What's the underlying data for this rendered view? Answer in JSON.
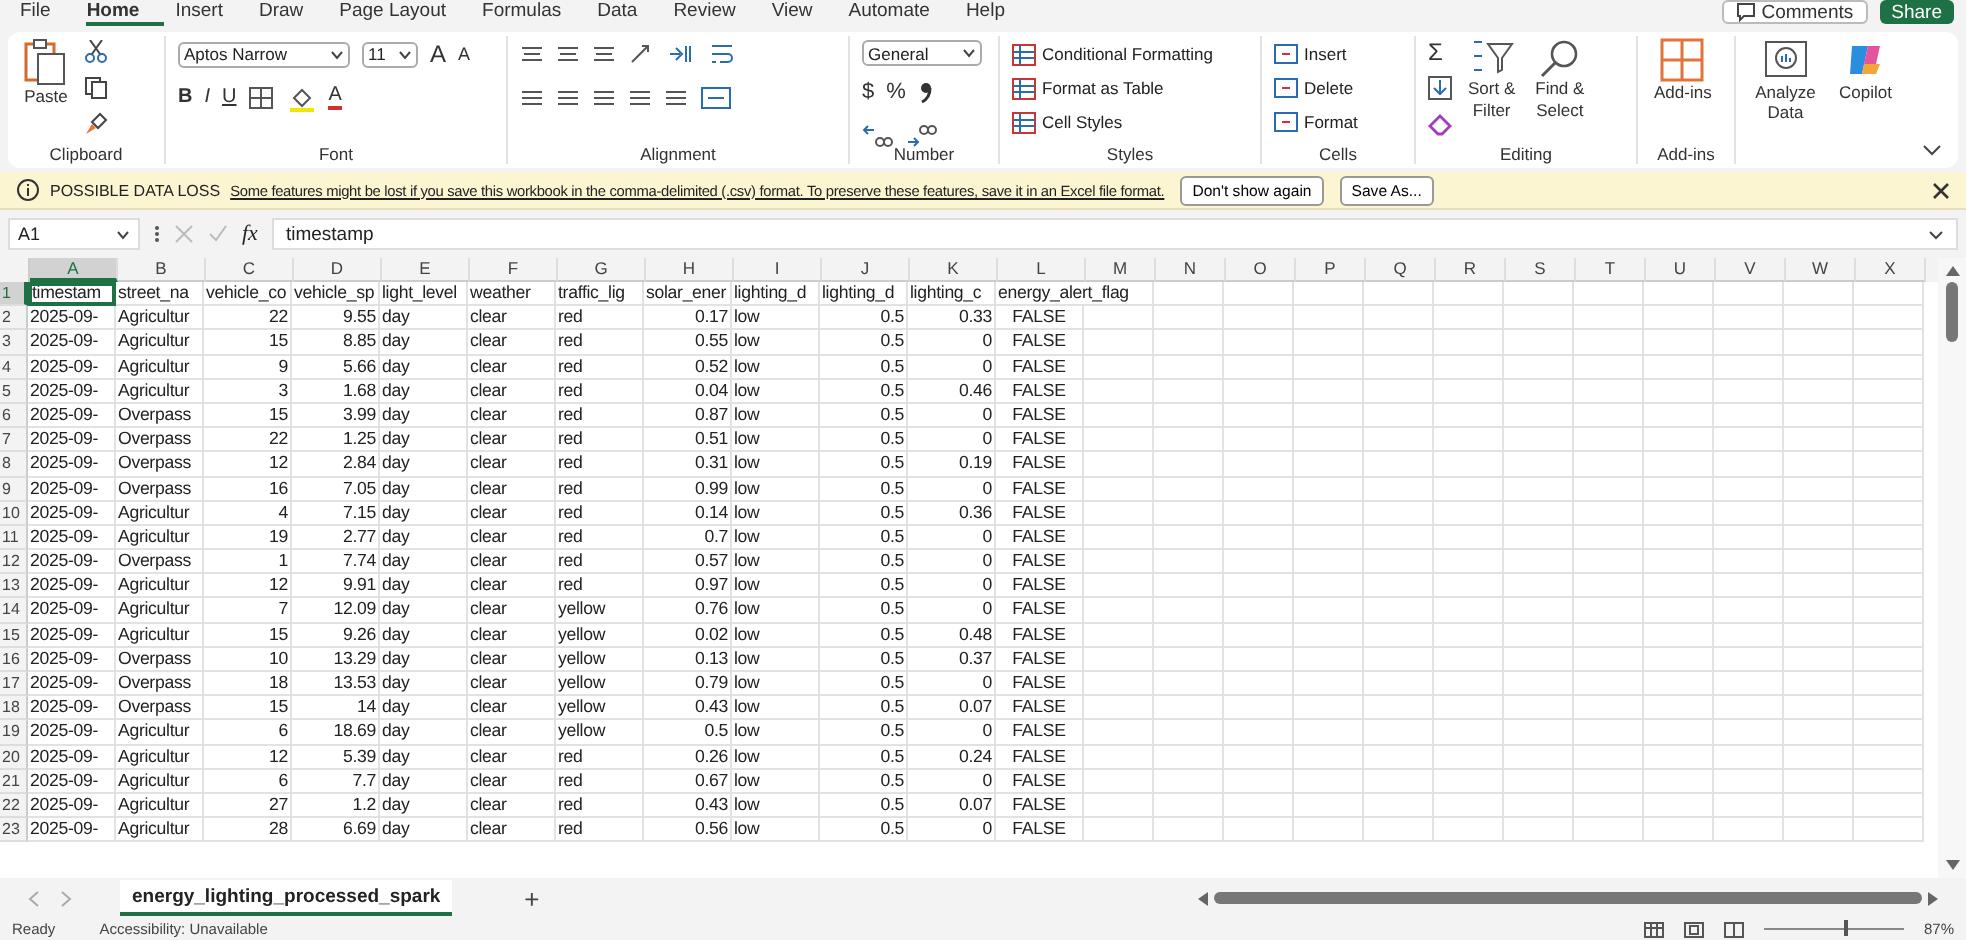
{
  "menu_tabs": [
    {
      "label": "File",
      "selected": false
    },
    {
      "label": "Home",
      "selected": true
    },
    {
      "label": "Insert",
      "selected": false
    },
    {
      "label": "Draw",
      "selected": false
    },
    {
      "label": "Page Layout",
      "selected": false
    },
    {
      "label": "Formulas",
      "selected": false
    },
    {
      "label": "Data",
      "selected": false
    },
    {
      "label": "Review",
      "selected": false
    },
    {
      "label": "View",
      "selected": false
    },
    {
      "label": "Automate",
      "selected": false
    },
    {
      "label": "Help",
      "selected": false
    }
  ],
  "header_buttons": {
    "comments": "Comments",
    "share": "Share"
  },
  "ribbon": {
    "clipboard": {
      "label": "Clipboard",
      "paste": "Paste"
    },
    "font": {
      "label": "Font",
      "name": "Aptos Narrow",
      "size": "11",
      "grow": "A",
      "shrink": "A",
      "styles": [
        "B",
        "I",
        "U"
      ],
      "color_glyph": "A"
    },
    "alignment": {
      "label": "Alignment"
    },
    "number": {
      "label": "Number",
      "format": "General",
      "currency": "$",
      "percent": "%"
    },
    "styles": {
      "label": "Styles",
      "items": [
        "Conditional Formatting",
        "Format as Table",
        "Cell Styles"
      ]
    },
    "cells": {
      "label": "Cells",
      "items": [
        "Insert",
        "Delete",
        "Format"
      ]
    },
    "editing": {
      "label": "Editing",
      "sum": "Σ",
      "sort": [
        "Sort &",
        "Filter"
      ],
      "find": [
        "Find &",
        "Select"
      ]
    },
    "addins": {
      "label": "Add-ins",
      "button": "Add-ins"
    },
    "extra": [
      "Analyze Data",
      "Copilot"
    ]
  },
  "info_bar": {
    "title": "POSSIBLE DATA LOSS",
    "message": "Some features might be lost if you save this workbook in the comma-delimited (.csv) format. To preserve these features, save it in an Excel file format.",
    "buttons": [
      "Don't show again",
      "Save As..."
    ]
  },
  "formula_bar": {
    "cell_ref": "A1",
    "fx": "fx",
    "value": "timestamp"
  },
  "columns": [
    {
      "letter": "A",
      "kind": "text",
      "selected": true
    },
    {
      "letter": "B",
      "kind": "text",
      "selected": false
    },
    {
      "letter": "C",
      "kind": "number",
      "selected": false
    },
    {
      "letter": "D",
      "kind": "number",
      "selected": false
    },
    {
      "letter": "E",
      "kind": "text",
      "selected": false
    },
    {
      "letter": "F",
      "kind": "text",
      "selected": false
    },
    {
      "letter": "G",
      "kind": "text",
      "selected": false
    },
    {
      "letter": "H",
      "kind": "number",
      "selected": false
    },
    {
      "letter": "I",
      "kind": "text",
      "selected": false
    },
    {
      "letter": "J",
      "kind": "number",
      "selected": false
    },
    {
      "letter": "K",
      "kind": "number",
      "selected": false
    },
    {
      "letter": "L",
      "kind": "flag",
      "selected": false
    },
    {
      "letter": "M",
      "kind": "text",
      "selected": false
    },
    {
      "letter": "N",
      "kind": "text",
      "selected": false
    },
    {
      "letter": "O",
      "kind": "text",
      "selected": false
    },
    {
      "letter": "P",
      "kind": "text",
      "selected": false
    },
    {
      "letter": "Q",
      "kind": "text",
      "selected": false
    },
    {
      "letter": "R",
      "kind": "text",
      "selected": false
    },
    {
      "letter": "S",
      "kind": "text",
      "selected": false
    },
    {
      "letter": "T",
      "kind": "text",
      "selected": false
    },
    {
      "letter": "U",
      "kind": "text",
      "selected": false
    },
    {
      "letter": "V",
      "kind": "text",
      "selected": false
    },
    {
      "letter": "W",
      "kind": "text",
      "selected": false
    },
    {
      "letter": "X",
      "kind": "text",
      "selected": false
    }
  ],
  "header_row": {
    "number": "1",
    "selected": true,
    "cells": [
      "timestam",
      "street_na",
      "vehicle_co",
      "vehicle_sp",
      "light_level",
      "weather",
      "traffic_lig",
      "solar_ener",
      "lighting_d",
      "lighting_d",
      "lighting_c",
      "energy_alert_flag"
    ]
  },
  "rows": [
    {
      "number": "2",
      "cells": [
        "2025-09-",
        "Agricultur",
        "22",
        "9.55",
        "day",
        "clear",
        "red",
        "0.17",
        "low",
        "0.5",
        "0.33",
        "FALSE"
      ]
    },
    {
      "number": "3",
      "cells": [
        "2025-09-",
        "Agricultur",
        "15",
        "8.85",
        "day",
        "clear",
        "red",
        "0.55",
        "low",
        "0.5",
        "0",
        "FALSE"
      ]
    },
    {
      "number": "4",
      "cells": [
        "2025-09-",
        "Agricultur",
        "9",
        "5.66",
        "day",
        "clear",
        "red",
        "0.52",
        "low",
        "0.5",
        "0",
        "FALSE"
      ]
    },
    {
      "number": "5",
      "cells": [
        "2025-09-",
        "Agricultur",
        "3",
        "1.68",
        "day",
        "clear",
        "red",
        "0.04",
        "low",
        "0.5",
        "0.46",
        "FALSE"
      ]
    },
    {
      "number": "6",
      "cells": [
        "2025-09-",
        "Overpass",
        "15",
        "3.99",
        "day",
        "clear",
        "red",
        "0.87",
        "low",
        "0.5",
        "0",
        "FALSE"
      ]
    },
    {
      "number": "7",
      "cells": [
        "2025-09-",
        "Overpass",
        "22",
        "1.25",
        "day",
        "clear",
        "red",
        "0.51",
        "low",
        "0.5",
        "0",
        "FALSE"
      ]
    },
    {
      "number": "8",
      "cells": [
        "2025-09-",
        "Overpass",
        "12",
        "2.84",
        "day",
        "clear",
        "red",
        "0.31",
        "low",
        "0.5",
        "0.19",
        "FALSE"
      ]
    },
    {
      "number": "9",
      "cells": [
        "2025-09-",
        "Overpass",
        "16",
        "7.05",
        "day",
        "clear",
        "red",
        "0.99",
        "low",
        "0.5",
        "0",
        "FALSE"
      ]
    },
    {
      "number": "10",
      "cells": [
        "2025-09-",
        "Agricultur",
        "4",
        "7.15",
        "day",
        "clear",
        "red",
        "0.14",
        "low",
        "0.5",
        "0.36",
        "FALSE"
      ]
    },
    {
      "number": "11",
      "cells": [
        "2025-09-",
        "Agricultur",
        "19",
        "2.77",
        "day",
        "clear",
        "red",
        "0.7",
        "low",
        "0.5",
        "0",
        "FALSE"
      ]
    },
    {
      "number": "12",
      "cells": [
        "2025-09-",
        "Overpass",
        "1",
        "7.74",
        "day",
        "clear",
        "red",
        "0.57",
        "low",
        "0.5",
        "0",
        "FALSE"
      ]
    },
    {
      "number": "13",
      "cells": [
        "2025-09-",
        "Agricultur",
        "12",
        "9.91",
        "day",
        "clear",
        "red",
        "0.97",
        "low",
        "0.5",
        "0",
        "FALSE"
      ]
    },
    {
      "number": "14",
      "cells": [
        "2025-09-",
        "Agricultur",
        "7",
        "12.09",
        "day",
        "clear",
        "yellow",
        "0.76",
        "low",
        "0.5",
        "0",
        "FALSE"
      ]
    },
    {
      "number": "15",
      "cells": [
        "2025-09-",
        "Agricultur",
        "15",
        "9.26",
        "day",
        "clear",
        "yellow",
        "0.02",
        "low",
        "0.5",
        "0.48",
        "FALSE"
      ]
    },
    {
      "number": "16",
      "cells": [
        "2025-09-",
        "Overpass",
        "10",
        "13.29",
        "day",
        "clear",
        "yellow",
        "0.13",
        "low",
        "0.5",
        "0.37",
        "FALSE"
      ]
    },
    {
      "number": "17",
      "cells": [
        "2025-09-",
        "Overpass",
        "18",
        "13.53",
        "day",
        "clear",
        "yellow",
        "0.79",
        "low",
        "0.5",
        "0",
        "FALSE"
      ]
    },
    {
      "number": "18",
      "cells": [
        "2025-09-",
        "Overpass",
        "15",
        "14",
        "day",
        "clear",
        "yellow",
        "0.43",
        "low",
        "0.5",
        "0.07",
        "FALSE"
      ]
    },
    {
      "number": "19",
      "cells": [
        "2025-09-",
        "Agricultur",
        "6",
        "18.69",
        "day",
        "clear",
        "yellow",
        "0.5",
        "low",
        "0.5",
        "0",
        "FALSE"
      ]
    },
    {
      "number": "20",
      "cells": [
        "2025-09-",
        "Agricultur",
        "12",
        "5.39",
        "day",
        "clear",
        "red",
        "0.26",
        "low",
        "0.5",
        "0.24",
        "FALSE"
      ]
    },
    {
      "number": "21",
      "cells": [
        "2025-09-",
        "Agricultur",
        "6",
        "7.7",
        "day",
        "clear",
        "red",
        "0.67",
        "low",
        "0.5",
        "0",
        "FALSE"
      ]
    },
    {
      "number": "22",
      "cells": [
        "2025-09-",
        "Agricultur",
        "27",
        "1.2",
        "day",
        "clear",
        "red",
        "0.43",
        "low",
        "0.5",
        "0.07",
        "FALSE"
      ]
    },
    {
      "number": "23",
      "cells": [
        "2025-09-",
        "Agricultur",
        "28",
        "6.69",
        "day",
        "clear",
        "red",
        "0.56",
        "low",
        "0.5",
        "0",
        "FALSE"
      ]
    }
  ],
  "sheet_tabs": [
    {
      "label": "energy_lighting_processed_spark",
      "selected": true
    }
  ],
  "add_sheet": "+",
  "status_bar": {
    "mode": "Ready",
    "accessibility": "Accessibility: Unavailable",
    "zoom": "87%",
    "zoom_slider": {
      "level": 0.57
    }
  }
}
